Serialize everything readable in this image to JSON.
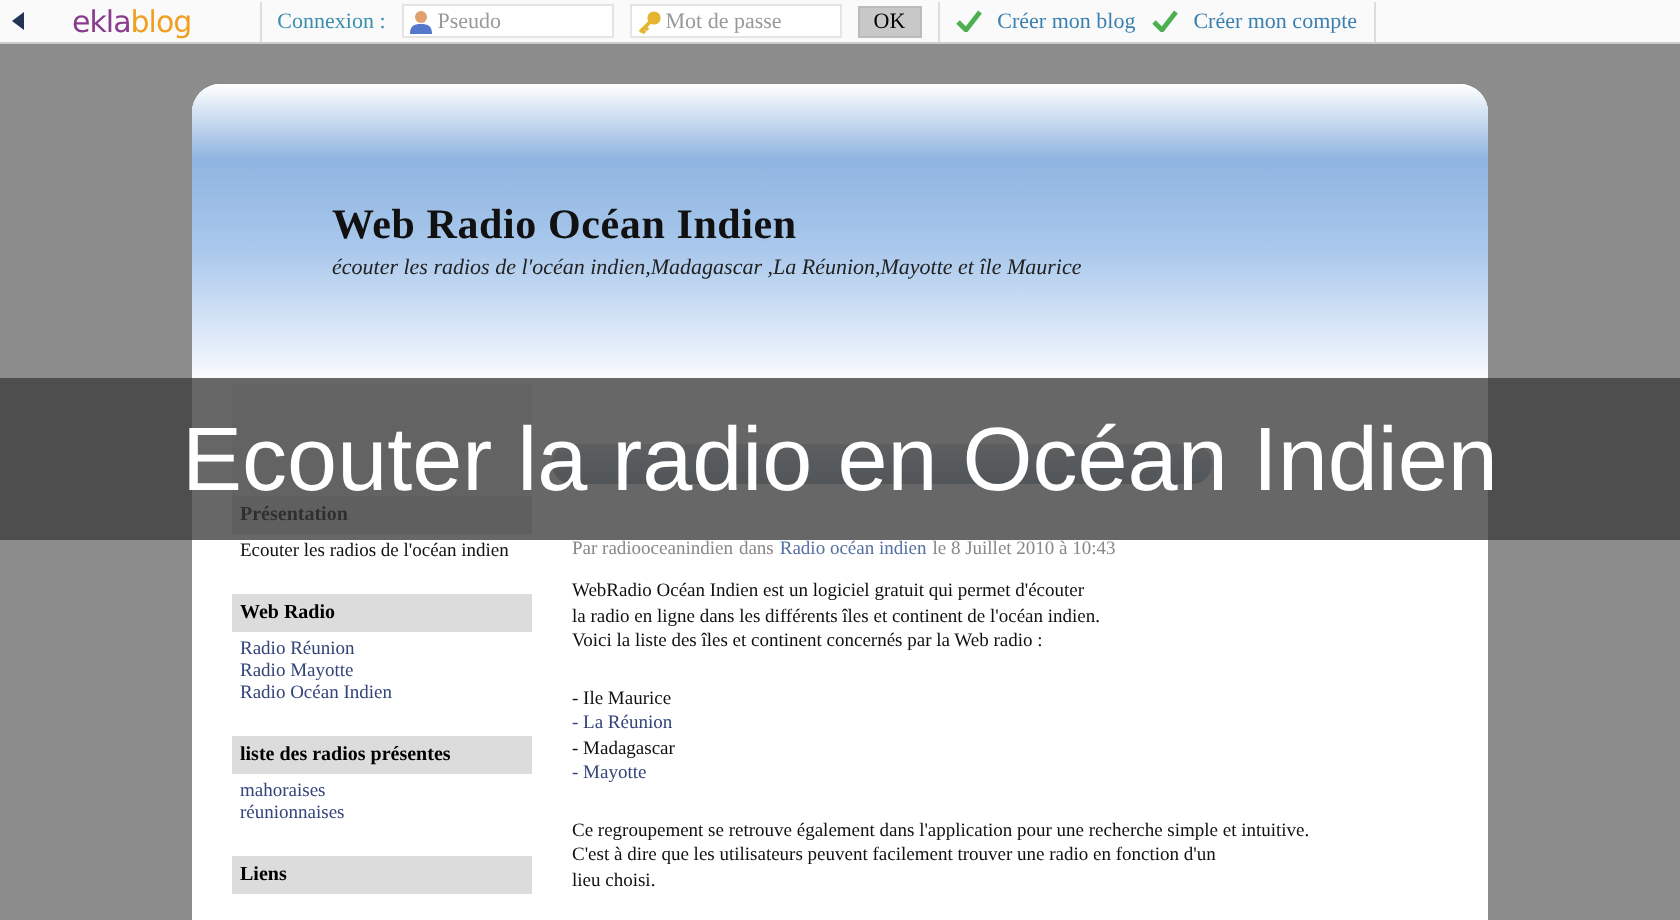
{
  "topbar": {
    "logo_parts": [
      "ekla",
      "blog"
    ],
    "login_label": "Connexion :",
    "username": {
      "placeholder": "Pseudo"
    },
    "password": {
      "placeholder": "Mot de passe"
    },
    "ok_button": "OK",
    "links": [
      "Créer mon blog",
      "Créer mon compte"
    ]
  },
  "header": {
    "title": "Web Radio Océan Indien",
    "subtitle": "écouter les radios de l'océan indien,Madagascar ,La Réunion,Mayotte et île Maurice"
  },
  "sidebar": [
    {
      "heading": "Présentation",
      "items": [
        {
          "text": "Ecouter les radios de l'océan indien",
          "link": false
        }
      ]
    },
    {
      "heading": "Web Radio",
      "items": [
        {
          "text": "Radio Réunion",
          "link": true
        },
        {
          "text": "Radio Mayotte",
          "link": true
        },
        {
          "text": "Radio Océan Indien",
          "link": true
        }
      ]
    },
    {
      "heading": "liste des radios présentes",
      "items": [
        {
          "text": "mahoraises",
          "link": true
        },
        {
          "text": "réunionnaises",
          "link": true
        }
      ]
    },
    {
      "heading": "Liens"
    }
  ],
  "post": {
    "meta": [
      {
        "text": "Par radiooceanindien",
        "link": false
      },
      {
        "text": "dans",
        "link": false
      },
      {
        "text": "Radio océan indien",
        "link": true
      },
      {
        "text": "le 8 Juillet 2010 à 10:43",
        "link": false
      }
    ],
    "intro": [
      "WebRadio Océan Indien est un logiciel gratuit qui permet d'écouter",
      "la radio en ligne dans les différents îles et continent de l'océan indien.",
      "Voici la liste des îles et continent concernés par la Web radio :"
    ],
    "list": [
      {
        "text": "- Ile Maurice",
        "link": false
      },
      {
        "text": "- La Réunion",
        "link": true
      },
      {
        "text": "- Madagascar",
        "link": false
      },
      {
        "text": "- Mayotte",
        "link": true
      }
    ],
    "outro": [
      "Ce regroupement se retrouve également dans l'application pour une recherche simple et intuitive.",
      "C'est à dire que les utilisateurs peuvent facilement trouver une radio en fonction d'un",
      "lieu choisi."
    ]
  },
  "overlay": {
    "caption": "Ecouter la radio en Océan Indien"
  }
}
